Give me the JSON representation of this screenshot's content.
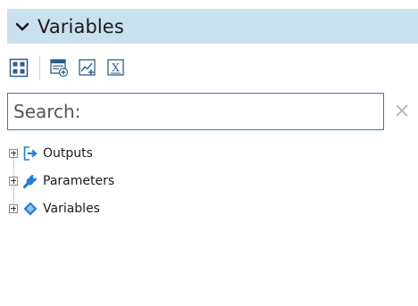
{
  "panel": {
    "title": "Variables",
    "header_color": "#c9e0ee"
  },
  "toolbar": {
    "buttons": [
      {
        "icon": "grid-view-icon"
      },
      {
        "icon": "add-table-icon"
      },
      {
        "icon": "add-chart-icon"
      },
      {
        "icon": "excel-icon"
      }
    ]
  },
  "search": {
    "placeholder": "Search:",
    "value": ""
  },
  "tree": {
    "items": [
      {
        "label": "Outputs",
        "icon": "output-arrow-icon",
        "color": "#1e7fd6"
      },
      {
        "label": "Parameters",
        "icon": "wrench-icon",
        "color": "#1e7fd6"
      },
      {
        "label": "Variables",
        "icon": "diamond-icon",
        "color": "#1e7fd6"
      }
    ]
  }
}
